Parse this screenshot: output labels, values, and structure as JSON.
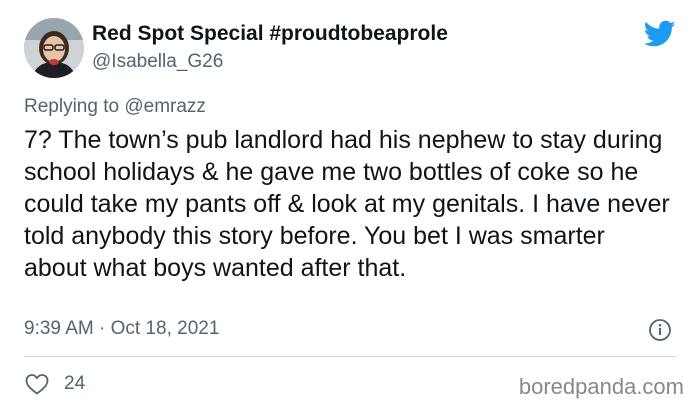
{
  "tweet": {
    "display_name": "Red Spot Special #proudtobeaprole",
    "handle": "@Isabella_G26",
    "replying_to_label": "Replying to",
    "replying_to_handle": "@emrazz",
    "text": "7?  The town’s pub landlord had his nephew to stay during school holidays & he gave me two bottles of coke so he could take my pants off & look at my genitals.  I have never told anybody this story before.  You bet I was smarter about what boys wanted after that.",
    "timestamp": "9:39 AM · Oct 18, 2021",
    "like_count": "24"
  },
  "watermark": "boredpanda.com",
  "colors": {
    "twitter_blue": "#1d9bf0",
    "secondary_text": "#536471",
    "primary_text": "#0f1419",
    "divider": "#cfd9de"
  },
  "icons": {
    "brand": "twitter-bird-icon",
    "info": "info-icon",
    "like": "heart-outline-icon"
  }
}
